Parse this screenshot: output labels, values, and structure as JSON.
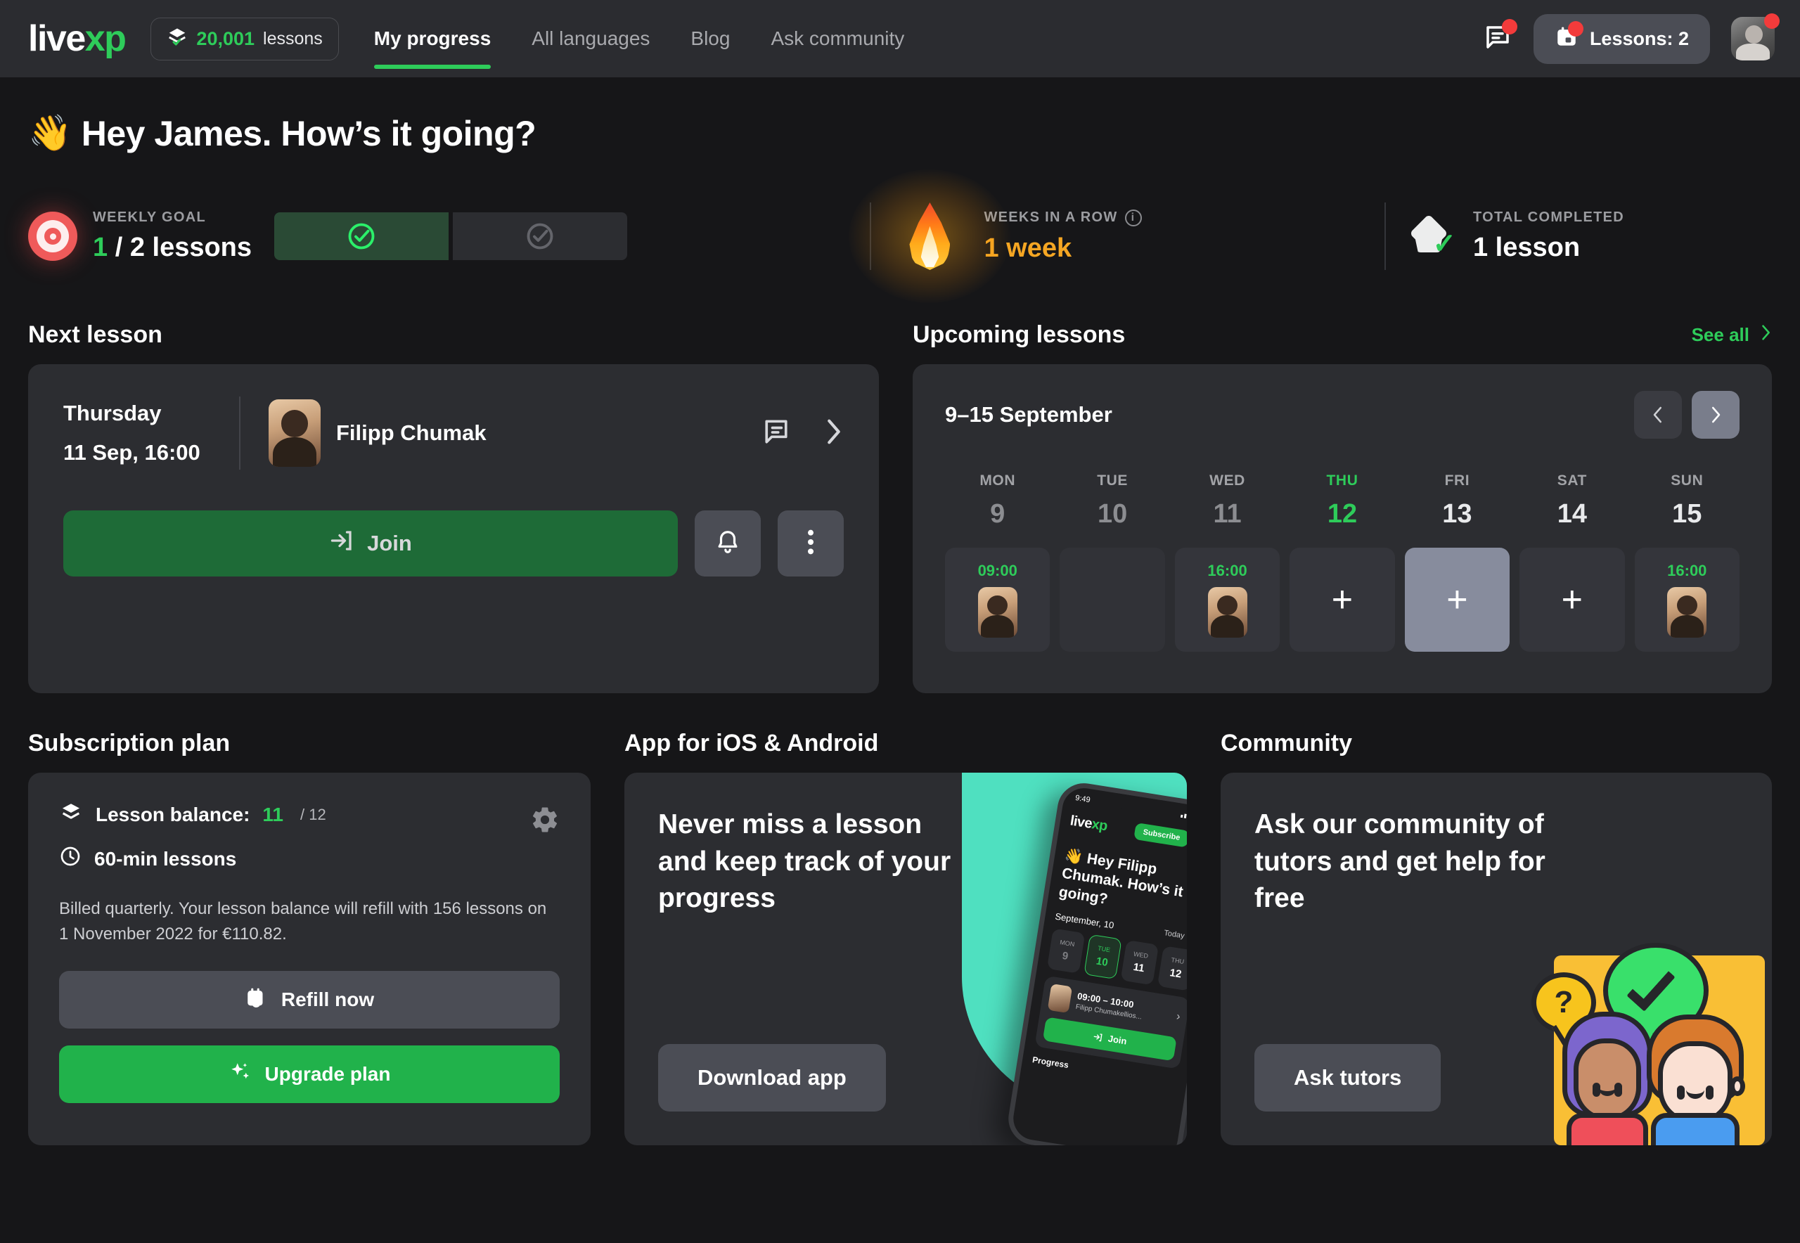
{
  "header": {
    "logo_live": "live",
    "logo_xp": "xp",
    "lessons_pill": {
      "count": "20,001",
      "word": "lessons",
      "icon": "stack-check-icon"
    },
    "nav": [
      {
        "label": "My progress",
        "active": true
      },
      {
        "label": "All languages",
        "active": false
      },
      {
        "label": "Blog",
        "active": false
      },
      {
        "label": "Ask community",
        "active": false
      }
    ],
    "chat_icon": "chat-icon",
    "lessons_button": {
      "label": "Lessons: 2",
      "icon": "calendar-icon"
    },
    "avatar": "user-avatar"
  },
  "greeting": {
    "emoji": "👋",
    "text": "Hey James. How’s it going?"
  },
  "stats": {
    "weekly_goal": {
      "label": "WEEKLY GOAL",
      "value_done": "1",
      "value_rest": " / 2 lessons",
      "segments_total": 2,
      "segments_done": 1
    },
    "weeks_in_a_row": {
      "label": "WEEKS IN A ROW",
      "value": "1 week",
      "info_icon": "info-icon"
    },
    "total_completed": {
      "label": "TOTAL COMPLETED",
      "value": "1 lesson"
    }
  },
  "next_lesson": {
    "title": "Next lesson",
    "day": "Thursday",
    "datetime": "11 Sep, 16:00",
    "tutor": "Filipp Chumak",
    "chat_icon": "chat-icon",
    "chevron_icon": "chevron-right-icon",
    "join_label": "Join",
    "join_icon": "enter-icon",
    "bell_icon": "bell-icon",
    "more_icon": "more-vertical-icon"
  },
  "upcoming": {
    "title": "Upcoming lessons",
    "see_all": "See all",
    "range": "9–15 September",
    "prev_icon": "chevron-left-icon",
    "next_icon": "chevron-right-icon",
    "days": [
      {
        "dow": "MON",
        "num": "9",
        "today": false,
        "dim": true,
        "time": "09:00",
        "kind": "booked"
      },
      {
        "dow": "TUE",
        "num": "10",
        "today": false,
        "dim": true,
        "time": "",
        "kind": "empty"
      },
      {
        "dow": "WED",
        "num": "11",
        "today": false,
        "dim": true,
        "time": "16:00",
        "kind": "booked"
      },
      {
        "dow": "THU",
        "num": "12",
        "today": true,
        "dim": false,
        "time": "",
        "kind": "add"
      },
      {
        "dow": "FRI",
        "num": "13",
        "today": false,
        "dim": false,
        "time": "",
        "kind": "add-highlight"
      },
      {
        "dow": "SAT",
        "num": "14",
        "today": false,
        "dim": false,
        "time": "",
        "kind": "add"
      },
      {
        "dow": "SUN",
        "num": "15",
        "today": false,
        "dim": false,
        "time": "16:00",
        "kind": "booked"
      }
    ]
  },
  "subscription": {
    "title": "Subscription plan",
    "balance_label": "Lesson balance:",
    "balance_value": "11",
    "balance_total": "/ 12",
    "duration": "60-min lessons",
    "billed_text": "Billed quarterly. Your lesson balance will refill with 156 lessons on 1 November 2022 for €110.82.",
    "refill_label": "Refill now",
    "refill_icon": "calendar-refresh-icon",
    "upgrade_label": "Upgrade plan",
    "upgrade_icon": "sparkles-icon",
    "gear_icon": "gear-icon",
    "balance_icon": "stack-check-icon",
    "clock_icon": "clock-icon"
  },
  "app_promo": {
    "title": "App for iOS & Android",
    "headline": "Never miss a lesson and keep track of your progress",
    "button": "Download app",
    "phone": {
      "time": "9:49",
      "logo_live": "live",
      "logo_xp": "xp",
      "subscribe": "Subscribe",
      "greeting_emoji": "👋",
      "greeting": "Hey Filipp Chumak. How’s it going?",
      "date": "September, 10",
      "today": "Today",
      "days": [
        {
          "dow": "MON",
          "num": "9",
          "state": "dim"
        },
        {
          "dow": "TUE",
          "num": "10",
          "state": "selected"
        },
        {
          "dow": "WED",
          "num": "11",
          "state": "normal"
        },
        {
          "dow": "THU",
          "num": "12",
          "state": "normal"
        }
      ],
      "lesson_time": "09:00 – 10:00",
      "lesson_tutor": "Filipp Chumakellios...",
      "join": "Join",
      "progress": "Progress"
    }
  },
  "community": {
    "title": "Community",
    "headline": "Ask our community of tutors and get help for free",
    "button": "Ask tutors"
  },
  "colors": {
    "page_bg": "#161618",
    "card_bg": "#2c2d31",
    "header_bg": "#2b2c30",
    "accent_green": "#2ecc5a",
    "button_green": "#21b24b",
    "join_green": "#1e6b37",
    "amber": "#f5a623",
    "red_badge": "#f33b3b",
    "teal": "#4fe0c0"
  }
}
